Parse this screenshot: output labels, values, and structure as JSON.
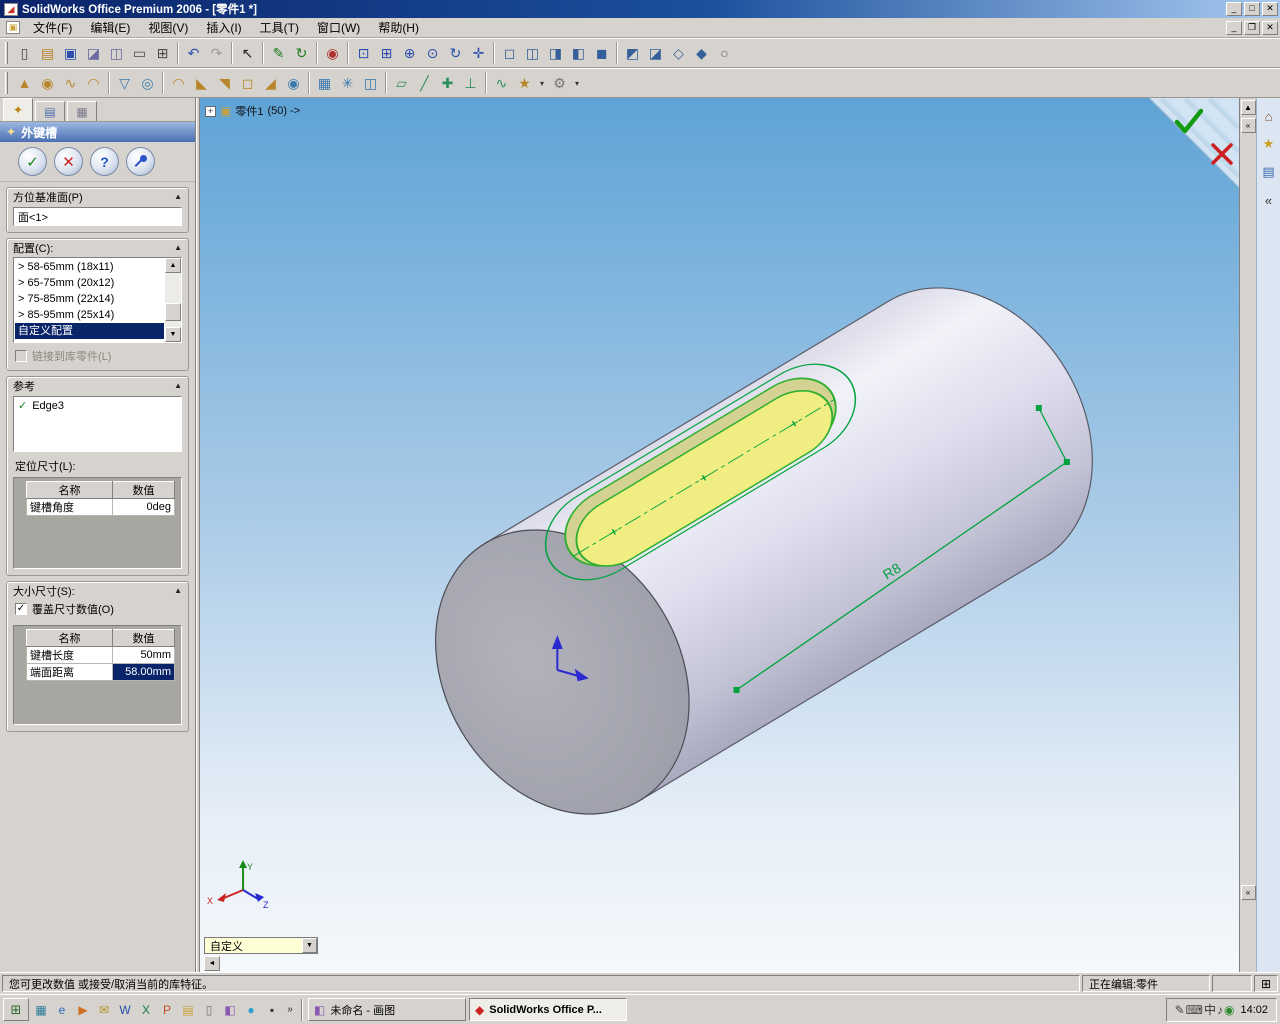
{
  "glyphs": {
    "check": "✓",
    "up": "▲",
    "down": "▼",
    "left": "◄",
    "chevL": "«",
    "more": "»",
    "plus": "+",
    "app": "◢",
    "doc": "▣",
    "start": "⊞"
  },
  "window": {
    "title": "SolidWorks Office Premium 2006 - [零件1 *]",
    "minimize": "_",
    "maximize": "□",
    "close": "✕",
    "mdi_minimize": "_",
    "mdi_restore": "❐",
    "mdi_close": "✕"
  },
  "menu": {
    "items": [
      {
        "label": "文件(F)"
      },
      {
        "label": "编辑(E)"
      },
      {
        "label": "视图(V)"
      },
      {
        "label": "插入(I)"
      },
      {
        "label": "工具(T)"
      },
      {
        "label": "窗口(W)"
      },
      {
        "label": "帮助(H)"
      }
    ]
  },
  "toolbar_main": {
    "items": [
      {
        "n": "new-icon",
        "g": "▯",
        "c": "#4a4a4a"
      },
      {
        "n": "open-icon",
        "g": "▤",
        "c": "#b8862a"
      },
      {
        "n": "save-icon",
        "g": "▣",
        "c": "#2b4fae"
      },
      {
        "n": "make-drawing-icon",
        "g": "◪",
        "c": "#6a6aa0"
      },
      {
        "n": "make-assembly-icon",
        "g": "◫",
        "c": "#6a6aa0"
      },
      {
        "n": "print-icon",
        "g": "▭",
        "c": "#4a4a4a"
      },
      {
        "n": "print-preview-icon",
        "g": "⊞",
        "c": "#4a4a4a"
      },
      {
        "cls": "sep"
      },
      {
        "n": "undo-icon",
        "g": "↶",
        "c": "#2b4fae"
      },
      {
        "n": "redo-icon",
        "g": "↷",
        "c": "#9a9a9a"
      },
      {
        "cls": "sep"
      },
      {
        "n": "select-icon",
        "g": "↖",
        "c": "#222222"
      },
      {
        "cls": "sep"
      },
      {
        "n": "sketch-icon",
        "g": "✎",
        "c": "#1f7a1f"
      },
      {
        "n": "rebuild-icon",
        "g": "↻",
        "c": "#1f7a1f"
      },
      {
        "cls": "sep"
      },
      {
        "n": "appearance-icon",
        "g": "◉",
        "c": "#b03030"
      },
      {
        "cls": "sep"
      },
      {
        "n": "zoom-fit-icon",
        "g": "⊡",
        "c": "#2b4fae"
      },
      {
        "n": "zoom-area-icon",
        "g": "⊞",
        "c": "#2b4fae"
      },
      {
        "n": "zoom-in-out-icon",
        "g": "⊕",
        "c": "#2b4fae"
      },
      {
        "n": "zoom-selection-icon",
        "g": "⊙",
        "c": "#2b4fae"
      },
      {
        "n": "rotate-view-icon",
        "g": "↻",
        "c": "#2b4fae"
      },
      {
        "n": "pan-icon",
        "g": "✛",
        "c": "#2b4fae"
      },
      {
        "cls": "sep"
      },
      {
        "n": "wireframe-icon",
        "g": "◻",
        "c": "#35609a"
      },
      {
        "n": "hidden-lines-visible-icon",
        "g": "◫",
        "c": "#35609a"
      },
      {
        "n": "hidden-lines-removed-icon",
        "g": "◨",
        "c": "#35609a"
      },
      {
        "n": "shaded-with-edges-icon",
        "g": "◧",
        "c": "#35609a"
      },
      {
        "n": "shaded-icon",
        "g": "◼",
        "c": "#35609a"
      },
      {
        "cls": "sep"
      },
      {
        "n": "shadows-icon",
        "g": "◩",
        "c": "#35609a"
      },
      {
        "n": "section-view-icon",
        "g": "◪",
        "c": "#35609a"
      },
      {
        "n": "standard-views-icon",
        "g": "◇",
        "c": "#35609a"
      },
      {
        "n": "view-orientation-icon",
        "g": "◆",
        "c": "#35609a"
      },
      {
        "n": "fullscreen-icon",
        "g": "○",
        "c": "#666666"
      }
    ]
  },
  "toolbar_features": {
    "items": [
      {
        "n": "extruded-boss-icon",
        "g": "▲",
        "c": "#b8862a"
      },
      {
        "n": "revolved-boss-icon",
        "g": "◉",
        "c": "#b8862a"
      },
      {
        "n": "swept-boss-icon",
        "g": "∿",
        "c": "#b8862a"
      },
      {
        "n": "lofted-boss-icon",
        "g": "◠",
        "c": "#b8862a"
      },
      {
        "cls": "sep"
      },
      {
        "n": "extruded-cut-icon",
        "g": "▽",
        "c": "#3a7ab0"
      },
      {
        "n": "revolved-cut-icon",
        "g": "◎",
        "c": "#3a7ab0"
      },
      {
        "cls": "sep"
      },
      {
        "n": "fillet-icon",
        "g": "◠",
        "c": "#b8862a"
      },
      {
        "n": "chamfer-icon",
        "g": "◣",
        "c": "#b8862a"
      },
      {
        "n": "rib-icon",
        "g": "◥",
        "c": "#b8862a"
      },
      {
        "n": "shell-icon",
        "g": "◻",
        "c": "#b8862a"
      },
      {
        "n": "draft-icon",
        "g": "◢",
        "c": "#b8862a"
      },
      {
        "n": "hole-wizard-icon",
        "g": "◉",
        "c": "#3a7ab0"
      },
      {
        "cls": "sep"
      },
      {
        "n": "linear-pattern-icon",
        "g": "▦",
        "c": "#3a7ab0"
      },
      {
        "n": "circular-pattern-icon",
        "g": "✳",
        "c": "#3a7ab0"
      },
      {
        "n": "mirror-feature-icon",
        "g": "◫",
        "c": "#3a7ab0"
      },
      {
        "cls": "sep"
      },
      {
        "n": "reference-plane-icon",
        "g": "▱",
        "c": "#2f8f5f"
      },
      {
        "n": "reference-axis-icon",
        "g": "╱",
        "c": "#2f8f5f"
      },
      {
        "n": "reference-point-icon",
        "g": "✚",
        "c": "#2f8f5f"
      },
      {
        "n": "coordinate-system-icon",
        "g": "⊥",
        "c": "#2f8f5f"
      },
      {
        "cls": "sep"
      },
      {
        "n": "curve-icon",
        "g": "∿",
        "c": "#2f8f5f"
      },
      {
        "n": "library-feature-icon",
        "g": "★",
        "c": "#b8862a"
      },
      {
        "n": "feature-dropdown-icon",
        "g": "▾",
        "c": "#333333",
        "cls": "dd"
      },
      {
        "n": "toolbox-icon",
        "g": "⚙",
        "c": "#777777"
      },
      {
        "n": "toolbox-dropdown-icon",
        "g": "▾",
        "c": "#333333",
        "cls": "dd"
      }
    ]
  },
  "panel": {
    "tabs": [
      {
        "n": "tab-propertymanager",
        "g": "✦",
        "c": "#b8860b",
        "cls": "active"
      },
      {
        "n": "tab-featuremanager",
        "g": "▤",
        "c": "#4a6ab0"
      },
      {
        "n": "tab-configurationmanager",
        "g": "▦",
        "c": "#7a7a8a"
      }
    ],
    "feature_icon": "✦",
    "title": "外键槽",
    "ok": "✓",
    "cancel": "✕",
    "help": "?",
    "orientation": {
      "label": "方位基准面(P)",
      "collapse": "▲",
      "value": "面<1>"
    },
    "config": {
      "label": "配置(C):",
      "collapse": "▲",
      "options": [
        {
          "label": "> 58-65mm  (18x11)"
        },
        {
          "label": "> 65-75mm  (20x12)"
        },
        {
          "label": "> 75-85mm  (22x14)"
        },
        {
          "label": "> 85-95mm  (25x14)"
        },
        {
          "label": "自定义配置",
          "cls": "selected"
        }
      ],
      "link_label": "链接到库零件(L)"
    },
    "reference": {
      "label": "参考",
      "collapse": "▲",
      "edge": "Edge3",
      "position_label": "定位尺寸(L):",
      "table": {
        "headers": [
          "名称",
          "数值"
        ],
        "rows": [
          {
            "name": "键槽角度",
            "value": "0deg"
          }
        ]
      }
    },
    "size": {
      "label": "大小尺寸(S):",
      "collapse": "▲",
      "override_label": "覆盖尺寸数值(O)",
      "table": {
        "headers": [
          "名称",
          "数值"
        ],
        "rows": [
          {
            "name": "键槽长度",
            "value": "50mm"
          },
          {
            "name": "端面距离",
            "value": "58.00mm",
            "cls": "selected"
          }
        ]
      }
    }
  },
  "viewport": {
    "doc_label": "零件1",
    "doc_suffix": "(50)  ->",
    "dimension_label": "R8",
    "config_dropdown": "自定义",
    "triad": {
      "x": "X",
      "y": "Y",
      "z": "Z"
    }
  },
  "right_pane": {
    "items": [
      {
        "n": "home-icon",
        "g": "⌂",
        "c": "#8a4a2a"
      },
      {
        "n": "design-library-icon",
        "g": "★",
        "c": "#c8a020"
      },
      {
        "n": "file-explorer-icon",
        "g": "▤",
        "c": "#3a6ab0"
      },
      {
        "n": "collapse-pane-icon",
        "g": "«",
        "c": "#333333"
      }
    ]
  },
  "statusbar": {
    "message": "您可更改数值 或接受/取消当前的库特征。",
    "editing": "正在编辑:零件"
  },
  "taskbar": {
    "quick_launch": [
      {
        "n": "show-desktop-icon",
        "g": "▦",
        "c": "#2a7a9a"
      },
      {
        "n": "ie-icon",
        "g": "e",
        "c": "#2b6bc0"
      },
      {
        "n": "media-player-icon",
        "g": "▶",
        "c": "#d07020"
      },
      {
        "n": "mail-icon",
        "g": "✉",
        "c": "#b09020"
      },
      {
        "n": "word-icon",
        "g": "W",
        "c": "#2b4fae"
      },
      {
        "n": "excel-icon",
        "g": "X",
        "c": "#1e7a45"
      },
      {
        "n": "powerpoint-icon",
        "g": "P",
        "c": "#c05020"
      },
      {
        "n": "folder-icon",
        "g": "▤",
        "c": "#c8a23a"
      },
      {
        "n": "notepad-icon",
        "g": "▯",
        "c": "#777777"
      },
      {
        "n": "paint-icon",
        "g": "◧",
        "c": "#8a5ab0"
      },
      {
        "n": "messenger-icon",
        "g": "●",
        "c": "#30a0d0"
      },
      {
        "n": "cmd-icon",
        "g": "▪",
        "c": "#333333"
      }
    ],
    "tasks": [
      {
        "n": "task-paint",
        "g": "◧",
        "c": "#8a5ab0",
        "label": "未命名 - 画图"
      },
      {
        "n": "task-solidworks",
        "g": "◆",
        "c": "#cc2222",
        "label": "SolidWorks Office P...",
        "cls": "active"
      }
    ],
    "tray": [
      {
        "n": "pen-icon",
        "g": "✎",
        "c": "#444444"
      },
      {
        "n": "keyboard-icon",
        "g": "⌨",
        "c": "#444444"
      },
      {
        "n": "input-method-icon",
        "g": "中",
        "c": "#333333"
      },
      {
        "n": "volume-icon",
        "g": "♪",
        "c": "#444444"
      },
      {
        "n": "antivirus-icon",
        "g": "◉",
        "c": "#2a8a2a"
      }
    ],
    "clock": "14:02"
  }
}
